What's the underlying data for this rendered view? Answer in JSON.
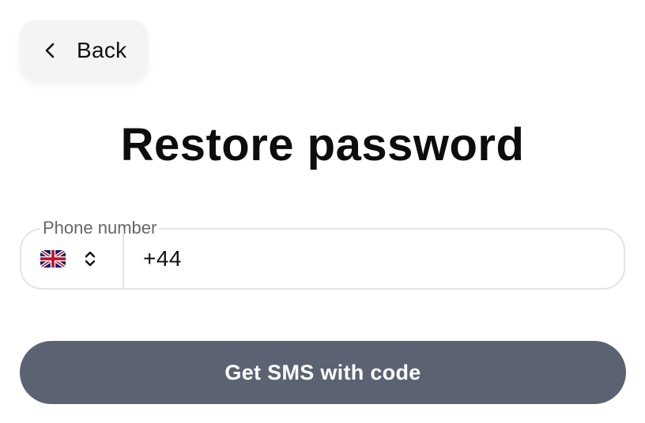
{
  "back_button": {
    "label": "Back",
    "icon": "chevron-left-icon"
  },
  "page": {
    "title": "Restore password"
  },
  "phone_field": {
    "label": "Phone number",
    "country": {
      "flag_icon": "uk-flag-icon",
      "selector_icon": "chevron-up-down-icon"
    },
    "value": "+44"
  },
  "submit_button": {
    "label": "Get SMS with code"
  },
  "colors": {
    "background": "#ffffff",
    "back_button_bg": "#f4f4f4",
    "submit_button_bg": "#5b6373",
    "submit_button_text": "#ffffff",
    "field_border": "#e4e4e4",
    "field_label": "#666666",
    "text": "#111111"
  }
}
